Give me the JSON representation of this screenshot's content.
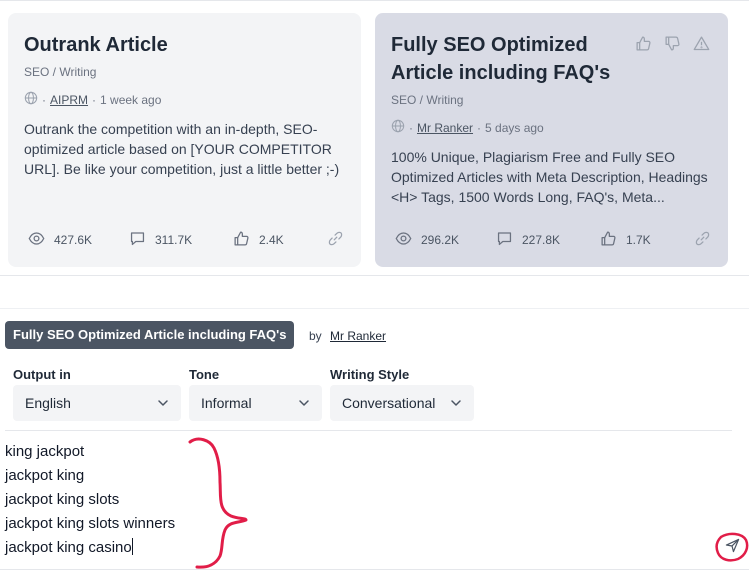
{
  "cards": [
    {
      "title": "Outrank Article",
      "category": "SEO / Writing",
      "author": "AIPRM",
      "age": "1 week ago",
      "description": "Outrank the competition with an in-depth, SEO-optimized article based on [YOUR COMPETITOR URL]. Be like your competition, just a little better ;-)",
      "views": "427.6K",
      "comments": "311.7K",
      "likes": "2.4K"
    },
    {
      "title": "Fully SEO Optimized Article including FAQ's",
      "category": "SEO / Writing",
      "author": "Mr Ranker",
      "age": "5 days ago",
      "description": "100% Unique, Plagiarism Free and Fully SEO Optimized Articles with Meta Description, Headings <H> Tags, 1500 Words Long, FAQ's, Meta...",
      "views": "296.2K",
      "comments": "227.8K",
      "likes": "1.7K"
    }
  ],
  "meta_separator": "·",
  "selected_prompt": {
    "title": "Fully SEO Optimized Article including FAQ's",
    "by_label": "by",
    "author": "Mr Ranker"
  },
  "options": {
    "output": {
      "label": "Output in",
      "value": "English"
    },
    "tone": {
      "label": "Tone",
      "value": "Informal"
    },
    "style": {
      "label": "Writing Style",
      "value": "Conversational"
    }
  },
  "prompt_input": {
    "lines": [
      "king jackpot",
      "jackpot king",
      "jackpot king slots",
      "jackpot king slots winners",
      "jackpot king casino"
    ]
  },
  "icons": {
    "views": "eye-icon",
    "comments": "comment-icon",
    "likes": "thumbs-up-icon",
    "link": "link-icon",
    "globe": "globe-icon",
    "dislike": "thumbs-down-icon",
    "report": "warning-icon",
    "dropdown": "chevron-down-icon",
    "send": "send-icon"
  },
  "colors": {
    "card_default": "#f3f4f6",
    "card_selected": "#d9dbe5",
    "pill": "#4b5563",
    "annotation": "#e11d48"
  }
}
